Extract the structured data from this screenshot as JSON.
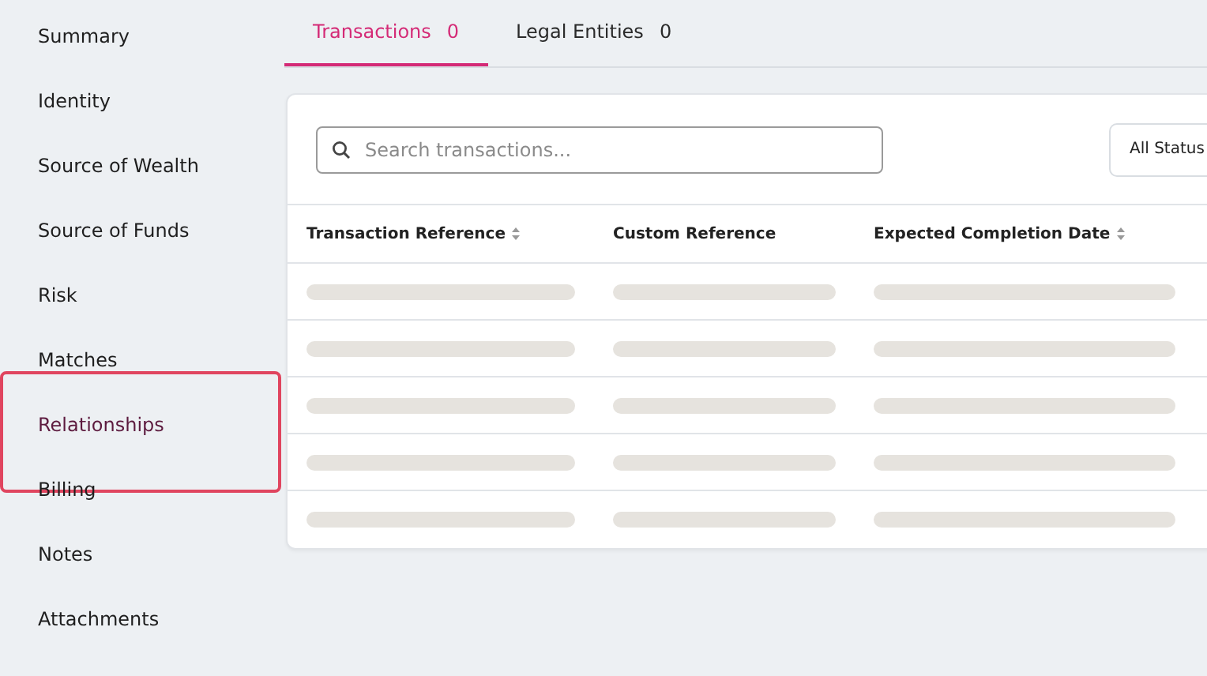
{
  "sidebar": {
    "items": [
      {
        "label": "Summary",
        "selected": false,
        "highlighted": false
      },
      {
        "label": "Identity",
        "selected": false,
        "highlighted": false
      },
      {
        "label": "Source of Wealth",
        "selected": false,
        "highlighted": false
      },
      {
        "label": "Source of Funds",
        "selected": false,
        "highlighted": false
      },
      {
        "label": "Risk",
        "selected": false,
        "highlighted": false
      },
      {
        "label": "Matches",
        "selected": false,
        "highlighted": false
      },
      {
        "label": "Relationships",
        "selected": true,
        "highlighted": true
      },
      {
        "label": "Billing",
        "selected": false,
        "highlighted": false
      },
      {
        "label": "Notes",
        "selected": false,
        "highlighted": false
      },
      {
        "label": "Attachments",
        "selected": false,
        "highlighted": false
      }
    ]
  },
  "tabs": [
    {
      "label": "Transactions",
      "count": "0",
      "selected": true
    },
    {
      "label": "Legal Entities",
      "count": "0",
      "selected": false
    }
  ],
  "search": {
    "placeholder": "Search transactions..."
  },
  "status_filter": {
    "value": "All Status"
  },
  "table": {
    "columns": [
      {
        "label": "Transaction Reference",
        "sortable": true
      },
      {
        "label": "Custom Reference",
        "sortable": false
      },
      {
        "label": "Expected Completion Date",
        "sortable": true
      }
    ],
    "rows": [
      {
        "loading": true
      },
      {
        "loading": true
      },
      {
        "loading": true
      },
      {
        "loading": true
      },
      {
        "loading": true
      }
    ]
  }
}
